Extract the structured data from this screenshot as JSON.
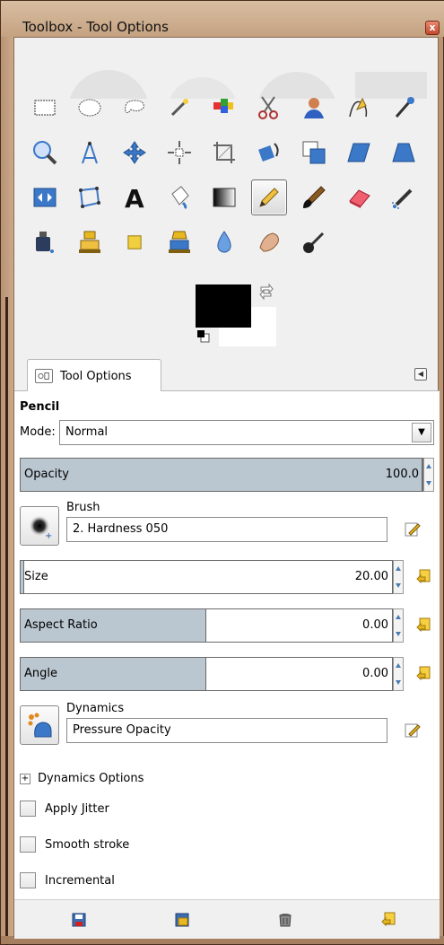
{
  "window": {
    "title": "Toolbox - Tool Options",
    "close_glyph": "x"
  },
  "toolbox": {
    "tools": [
      "rect-select-icon",
      "ellipse-select-icon",
      "free-select-icon",
      "fuzzy-select-icon",
      "color-select-icon",
      "scissors-select-icon",
      "foreground-select-icon",
      "paths-icon",
      "color-picker-icon",
      "zoom-icon",
      "measure-icon",
      "move-icon",
      "align-icon",
      "crop-icon",
      "rotate-icon",
      "scale-icon",
      "shear-icon",
      "perspective-icon",
      "flip-icon",
      "cage-transform-icon",
      "text-icon",
      "bucket-fill-icon",
      "blend-icon",
      "pencil-icon",
      "paintbrush-icon",
      "eraser-icon",
      "airbrush-icon",
      "ink-icon",
      "clone-icon",
      "heal-icon",
      "perspective-clone-icon",
      "blur-icon",
      "smudge-icon",
      "dodge-burn-icon"
    ],
    "active_tool": "pencil-icon",
    "foreground_color": "#000000",
    "background_color": "#ffffff"
  },
  "dock": {
    "tab_label": "Tool Options"
  },
  "options": {
    "tool_name": "Pencil",
    "mode_label": "Mode:",
    "mode_value": "Normal",
    "opacity": {
      "label": "Opacity",
      "value": "100.0",
      "fraction": 1.0
    },
    "brush": {
      "label": "Brush",
      "value": "2. Hardness 050"
    },
    "size": {
      "label": "Size",
      "value": "20.00",
      "fraction": 0.01
    },
    "aspect_ratio": {
      "label": "Aspect Ratio",
      "value": "0.00",
      "fraction": 0.5
    },
    "angle": {
      "label": "Angle",
      "value": "0.00",
      "fraction": 0.5
    },
    "dynamics": {
      "label": "Dynamics",
      "value": "Pressure Opacity"
    },
    "dynamics_options_label": "Dynamics Options",
    "checkboxes": [
      {
        "label": "Apply Jitter",
        "checked": false
      },
      {
        "label": "Smooth stroke",
        "checked": false
      },
      {
        "label": "Incremental",
        "checked": false
      }
    ]
  },
  "bottom_bar": [
    "save-options-icon",
    "restore-options-icon",
    "delete-options-icon",
    "reset-options-icon"
  ],
  "colors": {
    "slider_fill": "#bac6d0",
    "accent_blue": "#3c78c8",
    "reset_yellow": "#e8b820"
  }
}
